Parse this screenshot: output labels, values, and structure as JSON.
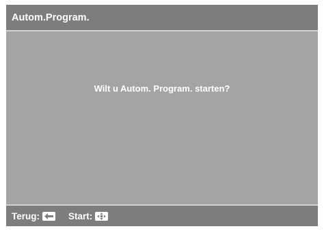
{
  "header": {
    "title": "Autom.Program."
  },
  "dialog": {
    "message": "Wilt u Autom. Program. starten?"
  },
  "footer": {
    "back_label": "Terug:",
    "back_icon": "arrow-left-icon",
    "start_label": "Start:",
    "start_icon": "select-center-icon"
  },
  "colors": {
    "screen_background": "#a4a4a4",
    "bar_background": "#7d7d7d",
    "divider": "#d2d2d2",
    "text": "#ffffff"
  }
}
